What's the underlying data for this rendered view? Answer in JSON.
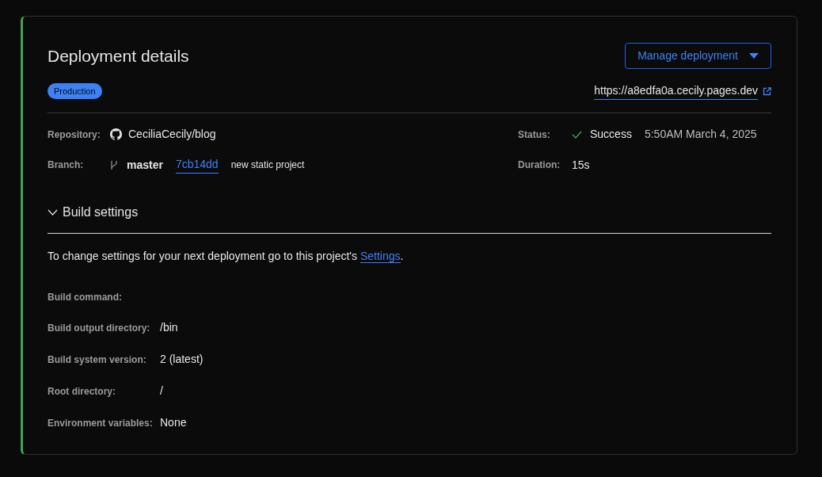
{
  "title": "Deployment details",
  "manage_button": {
    "label": "Manage deployment"
  },
  "environment_badge": "Production",
  "url": "https://a8edfa0a.cecily.pages.dev",
  "details": {
    "repository": {
      "label": "Repository:",
      "value": "CeciliaCecily/blog"
    },
    "branch": {
      "label": "Branch:",
      "name": "master",
      "commit": "7cb14dd",
      "message": "new static project"
    },
    "status": {
      "label": "Status:",
      "kind": "success",
      "value": "Success",
      "time": "5:50AM March 4, 2025"
    },
    "duration": {
      "label": "Duration:",
      "value": "15s"
    }
  },
  "build_settings": {
    "title": "Build settings",
    "expanded": true,
    "note": {
      "text": "To change settings for your next deployment go to this project's ",
      "link": "Settings",
      "end": "."
    },
    "rows": [
      {
        "label": "Build command:"
      },
      {
        "label": "Build output directory:",
        "value": "/bin"
      },
      {
        "label": "Build system version:",
        "value": "2 (latest)"
      },
      {
        "label": "Root directory:",
        "value": "/"
      },
      {
        "label": "Environment variables:",
        "value": "None"
      }
    ]
  }
}
